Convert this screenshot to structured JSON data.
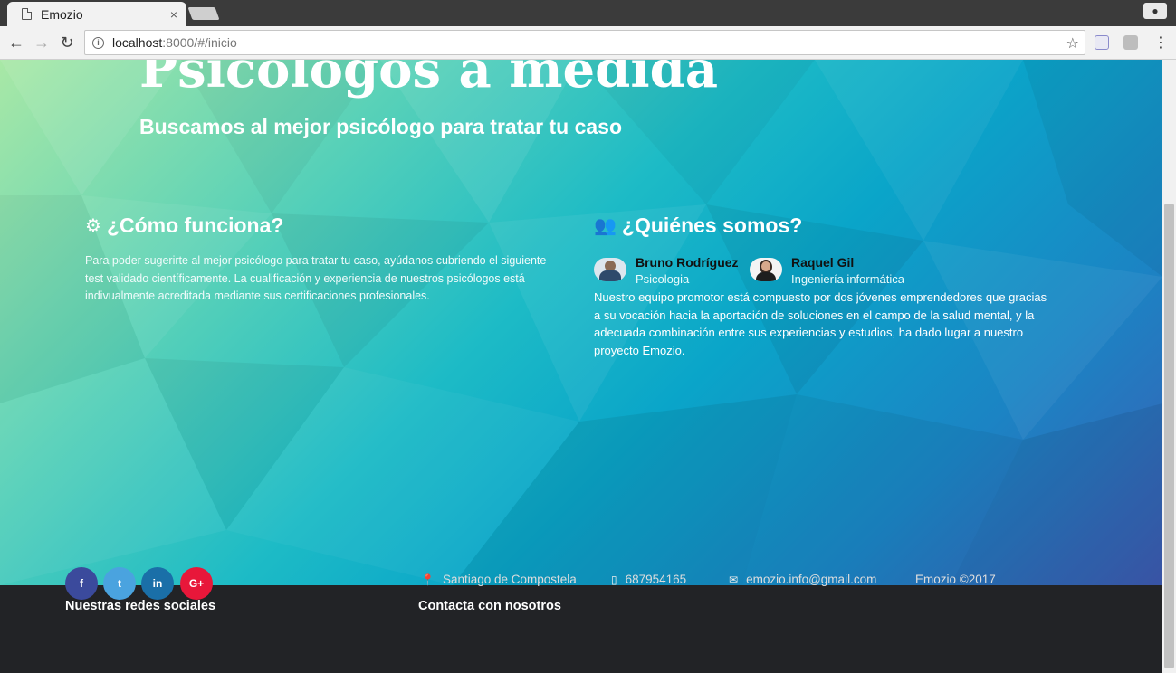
{
  "browser": {
    "tab_title": "Emozio",
    "close_glyph": "×",
    "url_host": "localhost",
    "url_rest": ":8000/#/inicio"
  },
  "hero": {
    "title": "Psicólogos a medida",
    "subtitle": "Buscamos al mejor psicólogo para tratar tu caso"
  },
  "how": {
    "icon": "gears-icon",
    "title": "¿Cómo funciona?",
    "text": "Para poder sugerirte al mejor psicólogo para tratar tu caso, ayúdanos cubriendo el siguiente test validado científicamente. La cualificación y experiencia de nuestros psicólogos está indivualmente acreditada mediante sus certificaciones profesionales."
  },
  "who": {
    "icon": "users-icon",
    "title": "¿Quiénes somos?",
    "people": [
      {
        "name": "Bruno Rodríguez",
        "role": "Psicologia"
      },
      {
        "name": "Raquel Gil",
        "role": "Ingeniería informática"
      }
    ],
    "text": "Nuestro equipo promotor está compuesto por dos jóvenes emprendedores que gracias a su vocación hacia la aportación de soluciones en el campo de la salud mental, y la adecuada combinación entre sus experiencias y estudios, ha dado lugar a nuestro proyecto Emozio."
  },
  "footer": {
    "social_title": "Nuestras redes sociales",
    "social": [
      {
        "icon": "facebook-icon",
        "glyph": "f",
        "color": "#3b4a9c"
      },
      {
        "icon": "twitter-icon",
        "glyph": "t",
        "color": "#4aa3df"
      },
      {
        "icon": "linkedin-icon",
        "glyph": "in",
        "color": "#1a6fa8"
      },
      {
        "icon": "google-plus-icon",
        "glyph": "G+",
        "color": "#e8173a"
      }
    ],
    "contact_title": "Contacta con nosotros",
    "location": "Santiago de Compostela",
    "phone": "687954165",
    "email": "emozio.info@gmail.com",
    "copyright": "Emozio ©2017"
  }
}
